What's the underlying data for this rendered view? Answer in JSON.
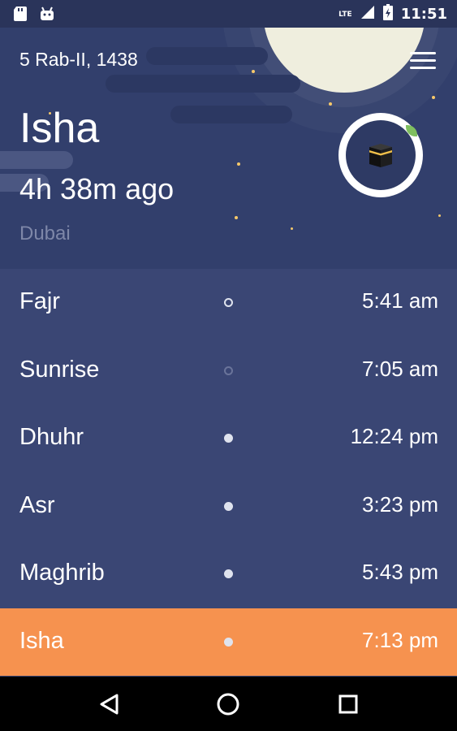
{
  "status_bar": {
    "time": "11:51",
    "network": "LTE",
    "left_icons": [
      "sd-card-icon",
      "android-icon"
    ],
    "right_icons": [
      "signal-icon",
      "battery-icon"
    ]
  },
  "header": {
    "hijri_date": "5 Rab-II, 1438",
    "current_prayer": "Isha",
    "time_since": "4h 38m ago",
    "city": "Dubai",
    "menu_icon": "hamburger-menu-icon",
    "qibla_icon": "kaaba-icon"
  },
  "prayers": [
    {
      "name": "Fajr",
      "time": "5:41 am",
      "marker": "ring"
    },
    {
      "name": "Sunrise",
      "time": "7:05 am",
      "marker": "ring-faint"
    },
    {
      "name": "Dhuhr",
      "time": "12:24 pm",
      "marker": "dot"
    },
    {
      "name": "Asr",
      "time": "3:23 pm",
      "marker": "dot"
    },
    {
      "name": "Maghrib",
      "time": "5:43 pm",
      "marker": "dot"
    },
    {
      "name": "Isha",
      "time": "7:13 pm",
      "marker": "dot",
      "active": true
    }
  ],
  "nav_bar": {
    "buttons": [
      "back-icon",
      "home-icon",
      "recents-icon"
    ]
  },
  "colors": {
    "background": "#3a4674",
    "header": "#323f6c",
    "active_row": "#f6924f",
    "moon": "#efeede"
  }
}
